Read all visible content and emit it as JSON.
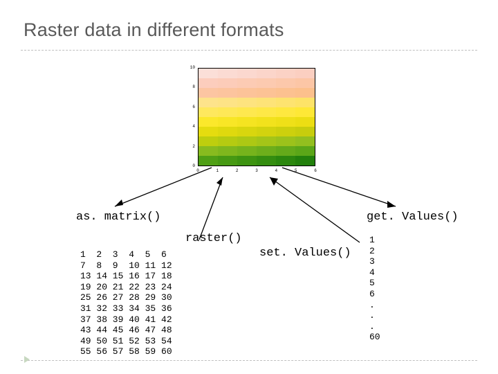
{
  "title": "Raster data in different formats",
  "labels": {
    "asmatrix": "as. matrix()",
    "raster": "raster()",
    "setvalues": "set. Values()",
    "getvalues": "get. Values()"
  },
  "matrix_text": "1  2  3  4  5  6\n7  8  9  10 11 12\n13 14 15 16 17 18\n19 20 21 22 23 24\n25 26 27 28 29 30\n31 32 33 34 35 36\n37 38 39 40 41 42\n43 44 45 46 47 48\n49 50 51 52 53 54\n55 56 57 58 59 60",
  "vector_text": "1\n2\n3\n4\n5\n6\n.\n.\n.\n60",
  "chart_data": {
    "type": "heatmap",
    "title": "",
    "xlabel": "",
    "ylabel": "",
    "x_ticks": [
      0,
      1,
      2,
      3,
      4,
      5,
      6
    ],
    "y_ticks": [
      0,
      2,
      4,
      6,
      8,
      10
    ],
    "grid_cols": 6,
    "grid_rows": 10,
    "values": [
      [
        1,
        2,
        3,
        4,
        5,
        6
      ],
      [
        7,
        8,
        9,
        10,
        11,
        12
      ],
      [
        13,
        14,
        15,
        16,
        17,
        18
      ],
      [
        19,
        20,
        21,
        22,
        23,
        24
      ],
      [
        25,
        26,
        27,
        28,
        29,
        30
      ],
      [
        31,
        32,
        33,
        34,
        35,
        36
      ],
      [
        37,
        38,
        39,
        40,
        41,
        42
      ],
      [
        43,
        44,
        45,
        46,
        47,
        48
      ],
      [
        49,
        50,
        51,
        52,
        53,
        54
      ],
      [
        55,
        56,
        57,
        58,
        59,
        60
      ]
    ],
    "row_colors": [
      [
        "#fbdfd8",
        "#fbdbd3",
        "#fbd8cf",
        "#fbd5ca",
        "#fbd2c5",
        "#fbcfc1"
      ],
      [
        "#fccdbd",
        "#fcccb9",
        "#fccbb4",
        "#fccab0",
        "#fcc8ab",
        "#fcc6a6"
      ],
      [
        "#fcc5a2",
        "#fcc49e",
        "#fcc399",
        "#fcc295",
        "#fcc190",
        "#fcc08c"
      ],
      [
        "#fde38b",
        "#fde386",
        "#fde37f",
        "#fde378",
        "#fde370",
        "#fde368"
      ],
      [
        "#fee85e",
        "#fee857",
        "#fee84f",
        "#fee847",
        "#fee83f",
        "#fee836"
      ],
      [
        "#fbe82b",
        "#f8e626",
        "#f5e421",
        "#f2e21c",
        "#efe018",
        "#ecde13"
      ],
      [
        "#e5dc0f",
        "#dfd90e",
        "#d9d60e",
        "#d3d30e",
        "#cdd00d",
        "#c7cd0d"
      ],
      [
        "#bece0e",
        "#b5cb11",
        "#adc814",
        "#a4c518",
        "#9cc21b",
        "#93bf1f"
      ],
      [
        "#88bb1f",
        "#7fb71d",
        "#76b31c",
        "#6dae1b",
        "#64aa1a",
        "#5ba618"
      ],
      [
        "#4f9f15",
        "#469913",
        "#3d9311",
        "#348d10",
        "#2b870e",
        "#22800c"
      ]
    ]
  }
}
